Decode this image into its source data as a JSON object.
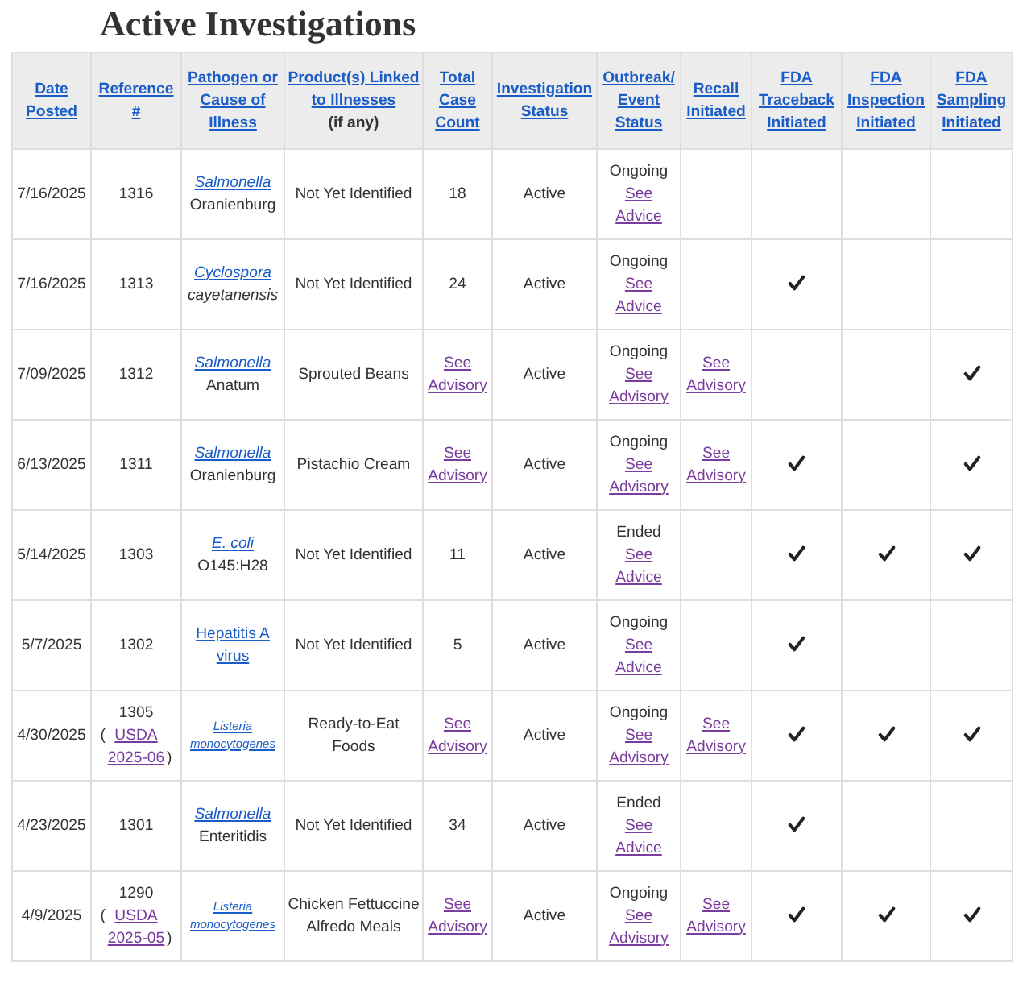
{
  "title": "Active Investigations",
  "table": {
    "columns": [
      {
        "label": "Date Posted"
      },
      {
        "label": "Reference #"
      },
      {
        "label": "Pathogen or Cause of Illness"
      },
      {
        "label": "Product(s) Linked to Illnesses",
        "note": "(if any)"
      },
      {
        "label": "Total Case Count"
      },
      {
        "label": "Investigation Status"
      },
      {
        "label": "Outbreak/ Event Status"
      },
      {
        "label": "Recall Initiated"
      },
      {
        "label": "FDA Traceback Initiated"
      },
      {
        "label": "FDA Inspection Initiated"
      },
      {
        "label": "FDA Sampling Initiated"
      }
    ],
    "rows": [
      {
        "date": "7/16/2025",
        "reference": {
          "number": "1316"
        },
        "pathogen": {
          "kind": "normal",
          "name": "Salmonella",
          "name_italic": true,
          "detail": "Oranienburg",
          "detail_italic": false
        },
        "products": {
          "kind": "text",
          "text": "Not Yet Identified"
        },
        "case_count": {
          "kind": "text",
          "text": "18"
        },
        "investigation_status": "Active",
        "outbreak": {
          "status": "Ongoing",
          "link": "See Advice",
          "visited": true
        },
        "traceback": false,
        "inspection": false,
        "sampling": false
      },
      {
        "date": "7/16/2025",
        "reference": {
          "number": "1313"
        },
        "pathogen": {
          "kind": "normal",
          "name": "Cyclospora",
          "name_italic": true,
          "detail": "cayetanensis",
          "detail_italic": true
        },
        "products": {
          "kind": "text",
          "text": "Not Yet Identified"
        },
        "case_count": {
          "kind": "text",
          "text": "24"
        },
        "investigation_status": "Active",
        "outbreak": {
          "status": "Ongoing",
          "link": "See Advice",
          "visited": true
        },
        "traceback": true,
        "inspection": false,
        "sampling": false
      },
      {
        "date": "7/09/2025",
        "reference": {
          "number": "1312"
        },
        "pathogen": {
          "kind": "normal",
          "name": "Salmonella",
          "name_italic": true,
          "detail": "Anatum",
          "detail_italic": false
        },
        "products": {
          "kind": "text",
          "text": "Sprouted Beans"
        },
        "case_count": {
          "kind": "link",
          "text": "See Advisory",
          "visited": true
        },
        "investigation_status": "Active",
        "outbreak": {
          "status": "Ongoing",
          "link": "See Advisory",
          "visited": true
        },
        "recall": {
          "text": "See Advisory",
          "visited": true
        },
        "traceback": false,
        "inspection": false,
        "sampling": true
      },
      {
        "date": "6/13/2025",
        "reference": {
          "number": "1311"
        },
        "pathogen": {
          "kind": "normal",
          "name": "Salmonella",
          "name_italic": true,
          "detail": "Oranienburg",
          "detail_italic": false
        },
        "products": {
          "kind": "text",
          "text": "Pistachio Cream"
        },
        "case_count": {
          "kind": "link",
          "text": "See Advisory",
          "visited": true
        },
        "investigation_status": "Active",
        "outbreak": {
          "status": "Ongoing",
          "link": "See Advisory",
          "visited": true
        },
        "recall": {
          "text": "See Advisory",
          "visited": true
        },
        "traceback": true,
        "inspection": false,
        "sampling": true
      },
      {
        "date": "5/14/2025",
        "reference": {
          "number": "1303"
        },
        "pathogen": {
          "kind": "normal",
          "name": "E. coli",
          "name_italic": true,
          "detail": "O145:H28",
          "detail_italic": false
        },
        "products": {
          "kind": "text",
          "text": "Not Yet Identified"
        },
        "case_count": {
          "kind": "text",
          "text": "11"
        },
        "investigation_status": "Active",
        "outbreak": {
          "status": "Ended",
          "link": "See Advice",
          "visited": true
        },
        "traceback": true,
        "inspection": true,
        "sampling": true
      },
      {
        "date": "5/7/2025",
        "reference": {
          "number": "1302"
        },
        "pathogen": {
          "kind": "normal",
          "name": "Hepatitis A virus",
          "name_italic": false
        },
        "products": {
          "kind": "text",
          "text": "Not Yet Identified"
        },
        "case_count": {
          "kind": "text",
          "text": "5"
        },
        "investigation_status": "Active",
        "outbreak": {
          "status": "Ongoing",
          "link": "See Advice",
          "visited": true
        },
        "traceback": true,
        "inspection": false,
        "sampling": false
      },
      {
        "date": "4/30/2025",
        "reference": {
          "number": "1305",
          "open": "(",
          "link": "USDA 2025-06",
          "close": ")"
        },
        "pathogen": {
          "kind": "compact",
          "name": "Listeria monocytogenes",
          "name_italic": true
        },
        "products": {
          "kind": "text",
          "text": "Ready-to-Eat Foods"
        },
        "case_count": {
          "kind": "link",
          "text": "See Advisory",
          "visited": true
        },
        "investigation_status": "Active",
        "outbreak": {
          "status": "Ongoing",
          "link": "See Advisory",
          "visited": true
        },
        "recall": {
          "text": "See Advisory",
          "visited": true
        },
        "traceback": true,
        "inspection": true,
        "sampling": true
      },
      {
        "date": "4/23/2025",
        "reference": {
          "number": "1301"
        },
        "pathogen": {
          "kind": "normal",
          "name": "Salmonella",
          "name_italic": true,
          "detail": "Enteritidis",
          "detail_italic": false
        },
        "products": {
          "kind": "text",
          "text": "Not Yet Identified"
        },
        "case_count": {
          "kind": "text",
          "text": "34"
        },
        "investigation_status": "Active",
        "outbreak": {
          "status": "Ended",
          "link": "See Advice",
          "visited": true
        },
        "traceback": true,
        "inspection": false,
        "sampling": false
      },
      {
        "date": "4/9/2025",
        "reference": {
          "number": "1290",
          "open": "(",
          "link": "USDA 2025-05",
          "close": ")"
        },
        "pathogen": {
          "kind": "compact",
          "name": "Listeria monocytogenes",
          "name_italic": true
        },
        "products": {
          "kind": "text",
          "text": "Chicken Fettuccine Alfredo Meals"
        },
        "case_count": {
          "kind": "link",
          "text": "See Advisory",
          "visited": true
        },
        "investigation_status": "Active",
        "outbreak": {
          "status": "Ongoing",
          "link": "See Advisory",
          "visited": true
        },
        "recall": {
          "text": "See Advisory",
          "visited": true
        },
        "traceback": true,
        "inspection": true,
        "sampling": true
      }
    ]
  }
}
